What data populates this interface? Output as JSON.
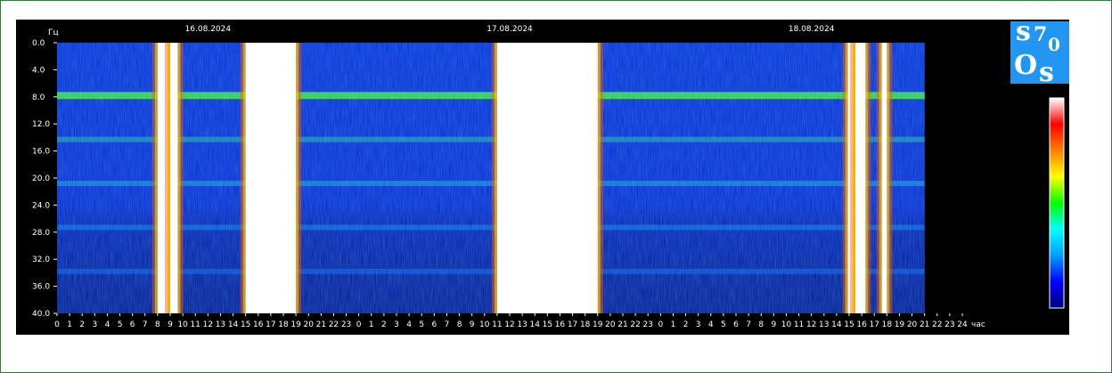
{
  "chart_data": {
    "type": "heatmap",
    "title": "",
    "ylabel": "Гц",
    "xlabel": "час",
    "ylim": [
      0,
      40
    ],
    "y_ticks": [
      "0.0",
      "4.0",
      "8.0",
      "12.0",
      "16.0",
      "20.0",
      "24.0",
      "28.0",
      "32.0",
      "36.0",
      "40.0"
    ],
    "x_ticks": [
      "0",
      "1",
      "2",
      "3",
      "4",
      "5",
      "6",
      "7",
      "8",
      "9",
      "10",
      "11",
      "12",
      "13",
      "14",
      "15",
      "16",
      "17",
      "18",
      "19",
      "20",
      "21",
      "22",
      "23",
      "0",
      "1",
      "2",
      "3",
      "4",
      "5",
      "6",
      "7",
      "8",
      "9",
      "10",
      "11",
      "12",
      "13",
      "14",
      "15",
      "16",
      "17",
      "18",
      "19",
      "20",
      "21",
      "22",
      "23",
      "0",
      "1",
      "2",
      "3",
      "4",
      "5",
      "6",
      "7",
      "8",
      "9",
      "10",
      "11",
      "12",
      "13",
      "14",
      "15",
      "16",
      "17",
      "18",
      "19",
      "20",
      "21",
      "22",
      "23",
      "24"
    ],
    "dates": [
      "16.08.2024",
      "17.08.2024",
      "18.08.2024"
    ],
    "data_end_hour": 69,
    "resonance_bands_hz": [
      7.8,
      14.3,
      20.8,
      27.3,
      33.8
    ],
    "saturated_intervals_hours": [
      [
        8.0,
        8.8
      ],
      [
        9.0,
        9.6
      ],
      [
        15.0,
        19.0
      ],
      [
        35.0,
        43.0
      ],
      [
        62.9,
        63.3
      ],
      [
        63.5,
        64.3
      ],
      [
        65.6,
        66.0
      ]
    ],
    "colormap": [
      "#000080",
      "#0000ff",
      "#00a0ff",
      "#00ffff",
      "#00ff00",
      "#ffff00",
      "#ff8000",
      "#ff0000",
      "#ffffff"
    ]
  },
  "logo": {
    "s1": "s",
    "n7": "7",
    "n0": "0",
    "o": "O",
    "s2": "s"
  }
}
